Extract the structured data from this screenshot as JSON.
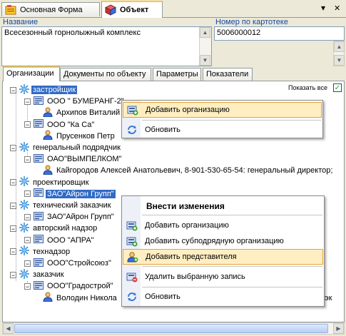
{
  "doc_tabs": [
    {
      "label": "Основная Форма"
    },
    {
      "label": "Объект"
    }
  ],
  "window_controls": {
    "dropdown": "▾",
    "close": "✕"
  },
  "fields": {
    "name_label": "Название",
    "name_value": "Всесезонный горнолыжный комплекс",
    "card_label": "Номер по картотеке",
    "card_value": "5006000012"
  },
  "tabs": [
    {
      "label": "Организации"
    },
    {
      "label": "Документы по объекту"
    },
    {
      "label": "Параметры"
    },
    {
      "label": "Показатели"
    }
  ],
  "show_all": {
    "label": "Показать все",
    "checked": true
  },
  "tree": [
    {
      "text": "застройщик",
      "kind": "category",
      "selected": true
    },
    {
      "text": "ООО \" БУМЕРАНГ-2\"",
      "kind": "org"
    },
    {
      "text": "Архипов Виталий",
      "kind": "person"
    },
    {
      "text": "ООО \"Ка Са\"",
      "kind": "org"
    },
    {
      "text": "Прусенков Петр",
      "kind": "person"
    },
    {
      "text": "генеральный подрядчик",
      "kind": "category"
    },
    {
      "text": "ОАО\"ВЫМПЕЛКОМ\"",
      "kind": "org"
    },
    {
      "text": "Кайгородов Алексей Анатольевич, 8-901-530-65-54:  генеральный директор;",
      "kind": "person"
    },
    {
      "text": "проектировщик",
      "kind": "category"
    },
    {
      "text": "ЗАО\"Айрон Групп\"",
      "kind": "org",
      "selected": true
    },
    {
      "text": "технический заказчик",
      "kind": "category"
    },
    {
      "text": "ЗАО\"Айрон Групп\"",
      "kind": "org"
    },
    {
      "text": "авторский надзор",
      "kind": "category"
    },
    {
      "text": "ООО   \"АПРА\"",
      "kind": "org"
    },
    {
      "text": "технадзор",
      "kind": "category"
    },
    {
      "text": "ООО\"Стройсоюз\"",
      "kind": "org"
    },
    {
      "text": "заказчик",
      "kind": "category"
    },
    {
      "text": "ООО\"Градострой\"",
      "kind": "org"
    },
    {
      "text": "Володин Никола",
      "kind": "person"
    },
    {
      "text": "эк",
      "kind": "overflow"
    }
  ],
  "menu1": {
    "items": [
      "Добавить организацию",
      "Обновить"
    ]
  },
  "menu2": {
    "title": "Внести изменения",
    "items": [
      "Добавить организацию",
      "Добавить субподрядную организацию",
      "Добавить представителя",
      "Удалить выбранную запись",
      "Обновить"
    ]
  },
  "colors": {
    "selection": "#316ac5",
    "menu_hover": "#ffeec2",
    "label_blue": "#1747a6"
  }
}
